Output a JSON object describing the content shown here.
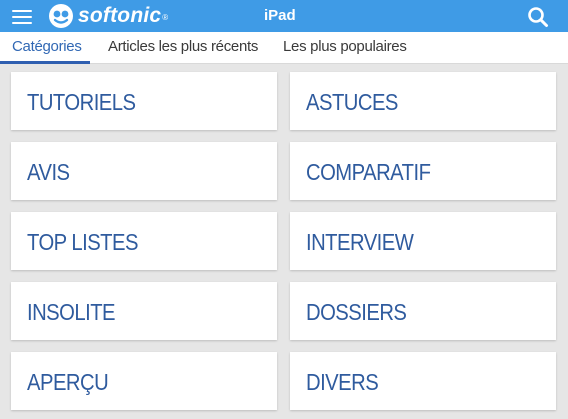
{
  "header": {
    "logo_text": "softonic",
    "logo_reg": "®",
    "title": "iPad",
    "menu_icon": "hamburger-menu-icon",
    "search_icon": "search-icon",
    "bar_color": "#3f9be6"
  },
  "tabs": [
    {
      "label": "Catégories",
      "active": true
    },
    {
      "label": "Articles les plus récents",
      "active": false
    },
    {
      "label": "Les plus populaires",
      "active": false
    }
  ],
  "categories": [
    {
      "label": "TUTORIELS"
    },
    {
      "label": "ASTUCES"
    },
    {
      "label": "AVIS"
    },
    {
      "label": "COMPARATIF"
    },
    {
      "label": "TOP LISTES"
    },
    {
      "label": "INTERVIEW"
    },
    {
      "label": "INSOLITE"
    },
    {
      "label": "DOSSIERS"
    },
    {
      "label": "APERÇU"
    },
    {
      "label": "DIVERS"
    }
  ],
  "colors": {
    "accent": "#2f5fb0",
    "category_text": "#2f5b9e",
    "background": "#e6e6e6"
  }
}
